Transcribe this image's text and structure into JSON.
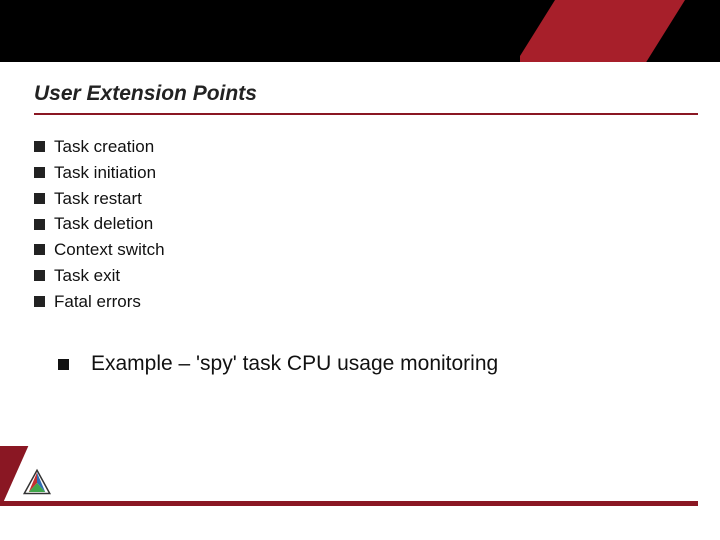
{
  "title": "User Extension Points",
  "bullets": [
    "Task creation",
    "Task initiation",
    "Task restart",
    "Task deletion",
    "Context switch",
    "Task exit",
    "Fatal errors"
  ],
  "sub_bullet": "Example – 'spy' task CPU usage monitoring"
}
